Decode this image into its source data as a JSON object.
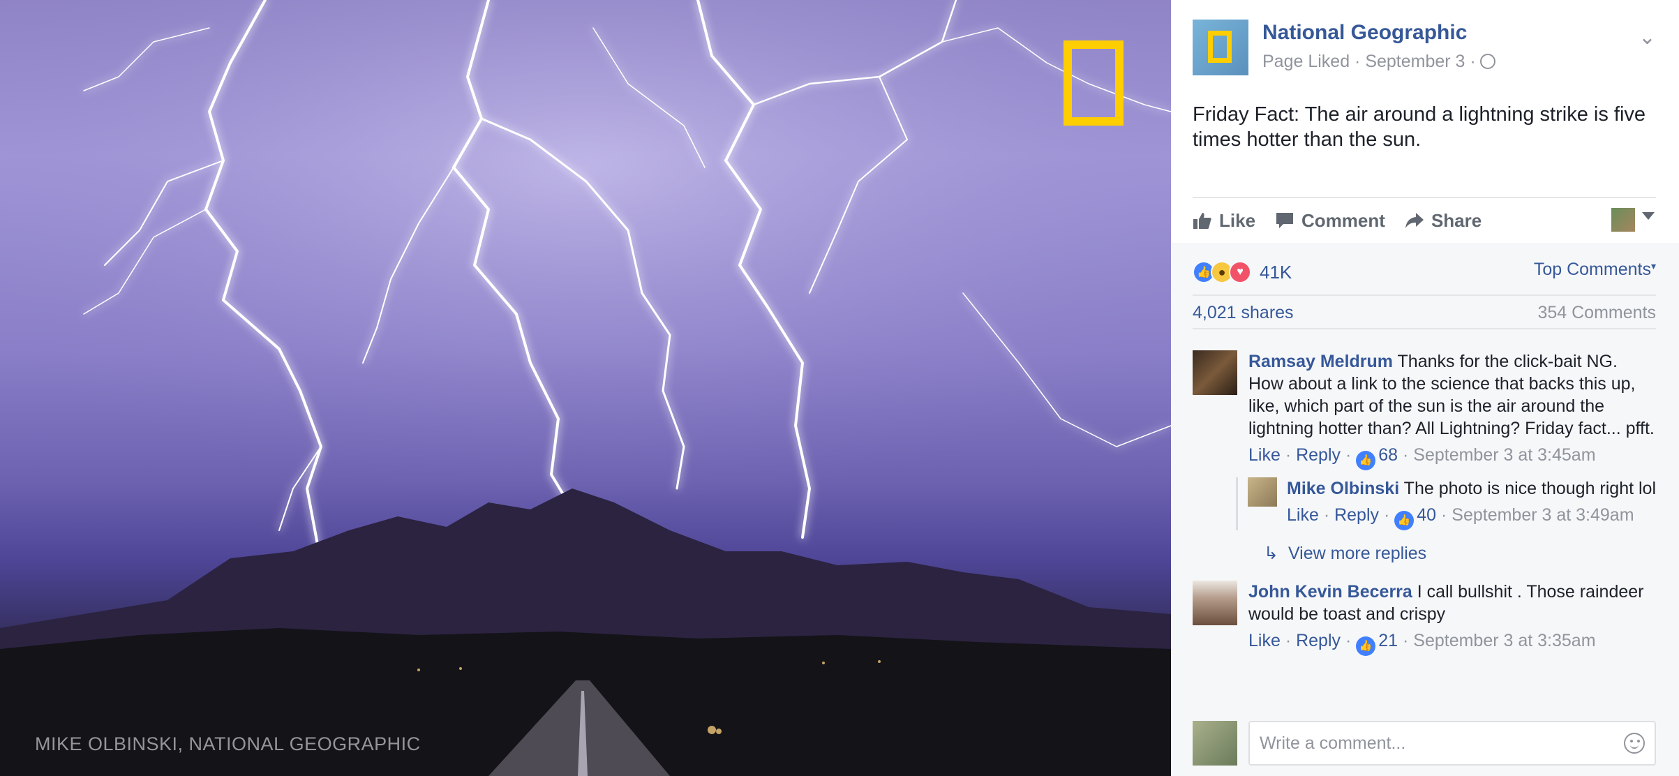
{
  "photo": {
    "credit": "MIKE OLBINSKI, NATIONAL GEOGRAPHIC"
  },
  "post": {
    "page_name": "National Geographic",
    "meta": "Page Liked · September 3 ·",
    "text": "Friday Fact: The air around a lightning strike is five times hotter than the sun."
  },
  "actions": {
    "like": "Like",
    "comment": "Comment",
    "share": "Share"
  },
  "reactions": {
    "count": "41K",
    "top_comments": "Top Comments",
    "shares": "4,021 shares",
    "comments_count": "354 Comments"
  },
  "comments": [
    {
      "author": "Ramsay Meldrum",
      "text": "Thanks for the click-bait NG. How about a link to the science that backs this up, like, which part of the sun is the air around the lightning hotter than? All Lightning? Friday fact... pfft.",
      "like": "Like",
      "reply": "Reply",
      "likes": "68",
      "time": "September 3 at 3:45am"
    },
    {
      "author": "John Kevin Becerra",
      "text": "I call bullshit . Those raindeer would be toast and crispy",
      "like": "Like",
      "reply": "Reply",
      "likes": "21",
      "time": "September 3 at 3:35am"
    }
  ],
  "reply": {
    "author": "Mike Olbinski",
    "text": "The photo is nice though right lol",
    "like": "Like",
    "reply": "Reply",
    "likes": "40",
    "time": "September 3 at 3:49am"
  },
  "view_more": "View more replies",
  "composer": {
    "placeholder": "Write a comment..."
  },
  "colors": {
    "link": "#365899",
    "muted": "#90949c",
    "ng_yellow": "#ffce00",
    "like_blue": "#4080ff",
    "love_red": "#f25268"
  }
}
